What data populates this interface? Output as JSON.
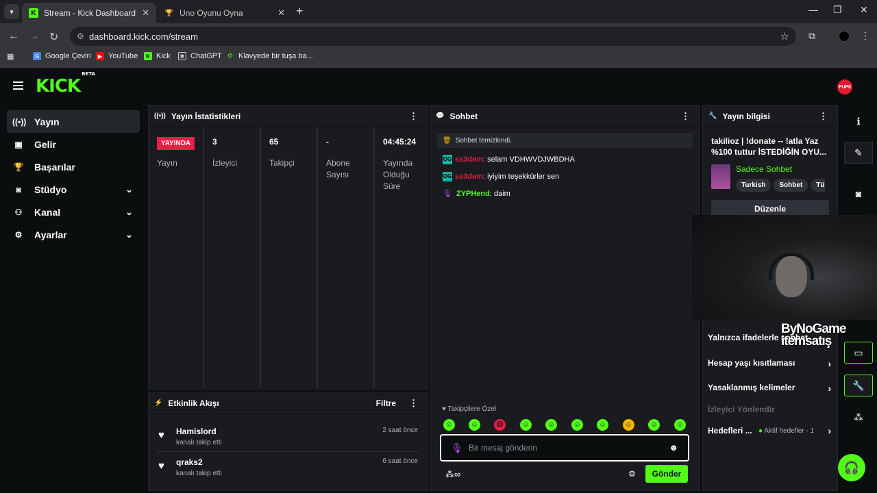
{
  "browser": {
    "tabs": [
      {
        "title": "Stream - Kick Dashboard",
        "active": true
      },
      {
        "title": "Uno Oyunu Oyna",
        "active": false
      }
    ],
    "url": "dashboard.kick.com/stream",
    "bookmarks": [
      "Google Çeviri",
      "YouTube",
      "Kick",
      "ChatGPT",
      "Klavyede bir tuşa ba..."
    ]
  },
  "app": {
    "logo": "KICK",
    "logo_tag": "BETA",
    "user_badge": "FUPII"
  },
  "sidebar": {
    "items": [
      {
        "label": "Yayın",
        "icon": "broadcast-icon"
      },
      {
        "label": "Gelir",
        "icon": "chart-icon"
      },
      {
        "label": "Başarılar",
        "icon": "trophy-icon"
      },
      {
        "label": "Stüdyo",
        "icon": "camera-icon"
      },
      {
        "label": "Kanal",
        "icon": "users-icon"
      },
      {
        "label": "Ayarlar",
        "icon": "gear-icon"
      }
    ]
  },
  "stats_panel": {
    "title": "Yayın İstatistikleri",
    "live_badge": "YAYINDA",
    "stats": [
      {
        "value": "",
        "label": "Yayın"
      },
      {
        "value": "3",
        "label": "İzleyici"
      },
      {
        "value": "65",
        "label": "Takipçi"
      },
      {
        "value": "-",
        "label": "Abone Sayısı"
      },
      {
        "value": "04:45:24",
        "label": "Yayında Olduğu Süre"
      }
    ]
  },
  "activity_panel": {
    "title": "Etkinlik Akışı",
    "filter_label": "Filtre",
    "events": [
      {
        "name": "Hamislord",
        "action": "kanalı takip etti",
        "time": "2 saat önce"
      },
      {
        "name": "qraks2",
        "action": "kanalı takip etti",
        "time": "6 saat önce"
      }
    ]
  },
  "chat_panel": {
    "title": "Sohbet",
    "system_message": "Sohbet temizlendi.",
    "messages": [
      {
        "user": "ss3dem",
        "text": ": selam VDHWVDJWBDHA"
      },
      {
        "user": "ss3dem",
        "text": ": iyiyim teşekkürler sen"
      },
      {
        "user": "ZYPHend",
        "text": ": daim"
      }
    ],
    "followers_only_label": "Takipçilere Özel",
    "input_placeholder": "Bir mesaj gönderin",
    "send_label": "Gönder"
  },
  "info_panel": {
    "title": "Yayın bilgisi",
    "stream_title": "takilioz | !donate -- !atla Yaz %100 tuttur İSTEDİĞİN OYU...",
    "category": "Sadece Sohbet",
    "tags": [
      "Turkish",
      "Sohbet",
      "Türk"
    ],
    "edit_label": "Düzenle"
  },
  "settings": {
    "emote_only": "Yalnızca ifadelerle sohbet",
    "account_age": "Hesap yaşı kısıtlaması",
    "banned_words": "Yasaklanmış kelimeler",
    "viewer_redirect": "İzleyici Yönlendir",
    "goals": "Hedefleri ...",
    "goals_status": "Aktif hedefler - 1"
  },
  "watermark": {
    "line1": "ByNoGame",
    "line2": "itemsatış"
  },
  "colors": {
    "brand": "#53fc18",
    "live": "#e91e43",
    "panel": "#191b1f"
  }
}
